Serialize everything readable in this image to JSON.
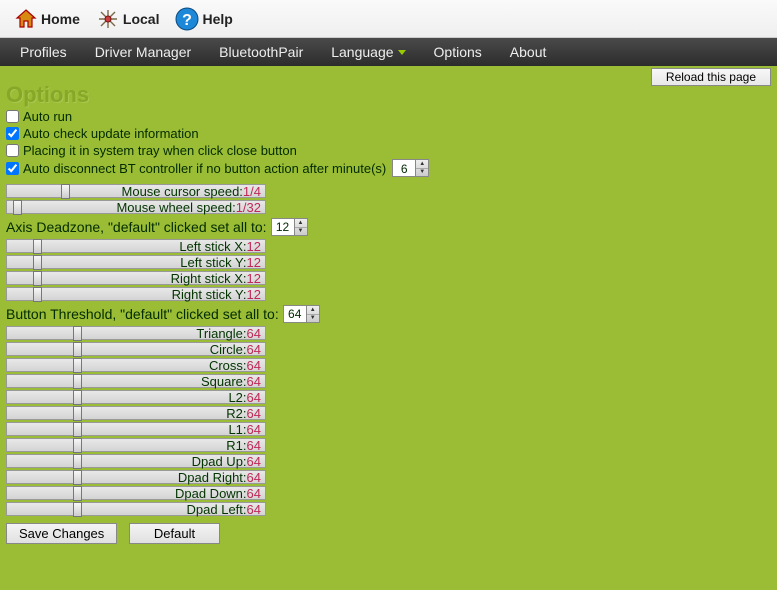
{
  "toolbar": {
    "home": "Home",
    "local": "Local",
    "help": "Help"
  },
  "menubar": {
    "profiles": "Profiles",
    "driver_manager": "Driver Manager",
    "bluetooth_pair": "BluetoothPair",
    "language": "Language",
    "options": "Options",
    "about": "About"
  },
  "reload_btn": "Reload this page",
  "title": "Options",
  "checkboxes": {
    "auto_run": {
      "label": "Auto run",
      "checked": false
    },
    "auto_check_update": {
      "label": "Auto check update information",
      "checked": true
    },
    "system_tray": {
      "label": "Placing it in system tray when click close button",
      "checked": false
    },
    "auto_disconnect": {
      "label": "Auto disconnect BT controller if no button action after minute(s)",
      "checked": true,
      "value": "6"
    }
  },
  "mouse": {
    "cursor_speed": {
      "label": "Mouse cursor speed:",
      "value": "1/4",
      "pos": 54
    },
    "wheel_speed": {
      "label": "Mouse wheel speed:",
      "value": "1/32",
      "pos": 6
    }
  },
  "axis_deadzone": {
    "label": "Axis Deadzone, \"default\" clicked set all to:",
    "value": "12",
    "items": [
      {
        "label": "Left stick X:",
        "value": "12",
        "pos": 26
      },
      {
        "label": "Left stick Y:",
        "value": "12",
        "pos": 26
      },
      {
        "label": "Right stick X:",
        "value": "12",
        "pos": 26
      },
      {
        "label": "Right stick Y:",
        "value": "12",
        "pos": 26
      }
    ]
  },
  "button_threshold": {
    "label": "Button Threshold, \"default\" clicked set all to:",
    "value": "64",
    "items": [
      {
        "label": "Triangle:",
        "value": "64",
        "pos": 66
      },
      {
        "label": "Circle:",
        "value": "64",
        "pos": 66
      },
      {
        "label": "Cross:",
        "value": "64",
        "pos": 66
      },
      {
        "label": "Square:",
        "value": "64",
        "pos": 66
      },
      {
        "label": "L2:",
        "value": "64",
        "pos": 66
      },
      {
        "label": "R2:",
        "value": "64",
        "pos": 66
      },
      {
        "label": "L1:",
        "value": "64",
        "pos": 66
      },
      {
        "label": "R1:",
        "value": "64",
        "pos": 66
      },
      {
        "label": "Dpad Up:",
        "value": "64",
        "pos": 66
      },
      {
        "label": "Dpad Right:",
        "value": "64",
        "pos": 66
      },
      {
        "label": "Dpad Down:",
        "value": "64",
        "pos": 66
      },
      {
        "label": "Dpad Left:",
        "value": "64",
        "pos": 66
      }
    ]
  },
  "buttons": {
    "save": "Save Changes",
    "default": "Default"
  }
}
